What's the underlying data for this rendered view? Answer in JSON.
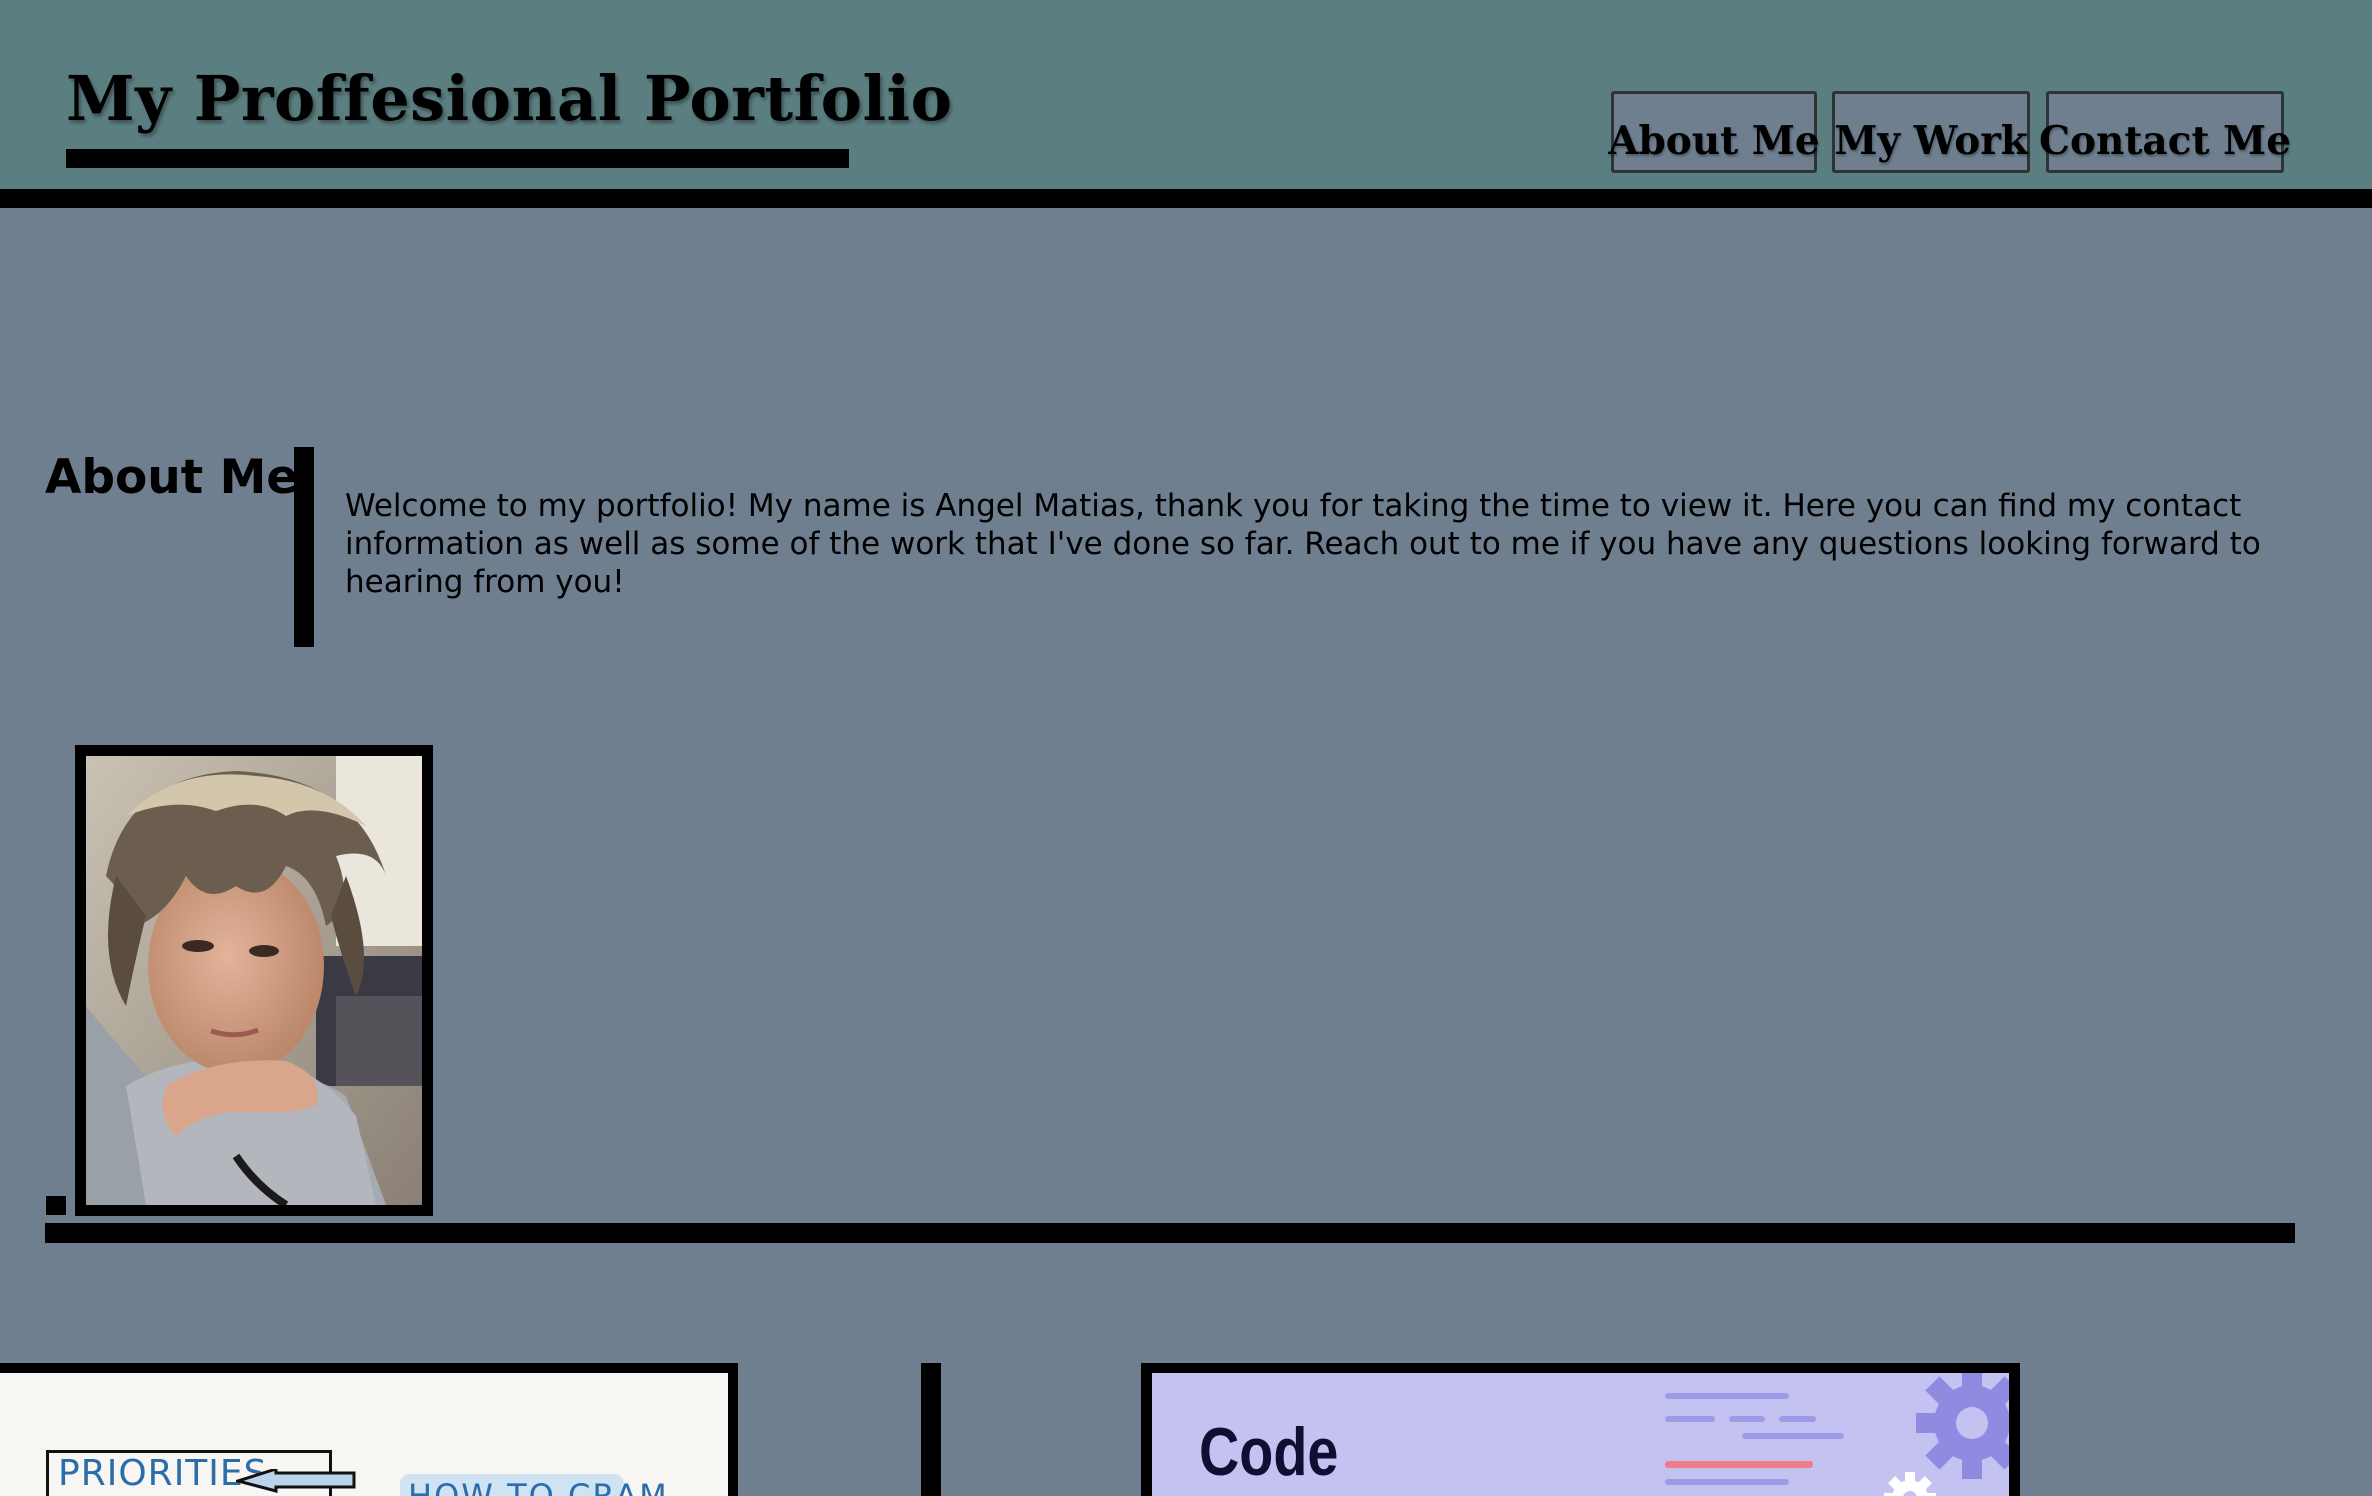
{
  "header": {
    "title": "My Proffesional Portfolio",
    "nav": [
      {
        "label": "About Me"
      },
      {
        "label": "My Work"
      },
      {
        "label": "Contact Me"
      }
    ]
  },
  "about": {
    "heading": "About Me",
    "text": "Welcome to my portfolio! My name is Angel Matias, thank you for taking the time to view it. Here you can find my contact information as well as some of the work that I've done so far. Reach out to me if you have any questions looking forward to hearing from you!"
  },
  "work": {
    "cards": [
      {
        "texts": [
          "PRIORITIES",
          "HOW TO CRAM"
        ]
      },
      {
        "title": "Code"
      }
    ]
  },
  "colors": {
    "header_bg": "#5b7e81",
    "page_bg": "#6f7f8f",
    "accent_black": "#000000",
    "code_card_bg": "#c3c2f0",
    "handwriting_blue": "#2b6dab"
  },
  "icons": [
    "gear-icon",
    "arrow-left-icon"
  ]
}
